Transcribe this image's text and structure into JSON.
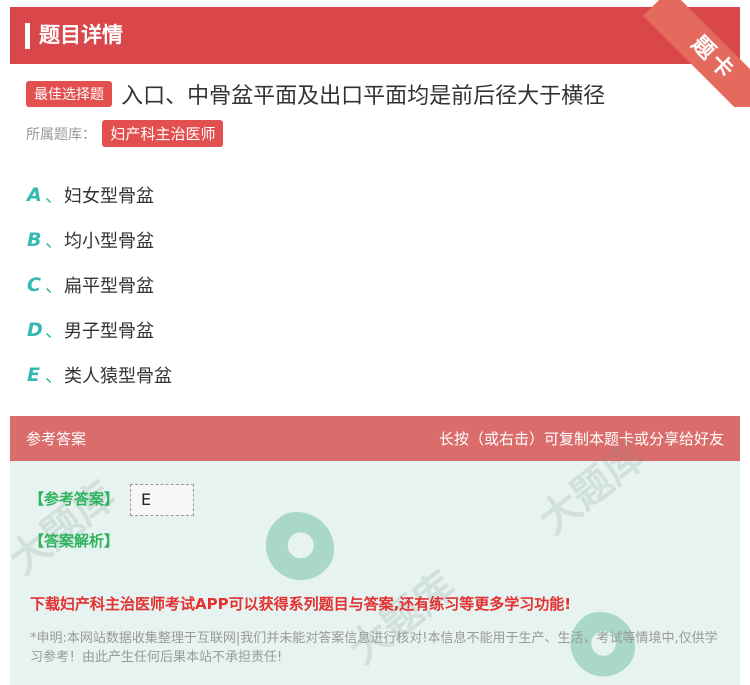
{
  "header": {
    "title": "题目详情",
    "ribbon": "题卡"
  },
  "question": {
    "type_tag": "最佳选择题",
    "text": "入口、中骨盆平面及出口平面均是前后径大于横径",
    "bank_label": "所属题库：",
    "bank_name": "妇产科主治医师"
  },
  "options": [
    {
      "letter": "A",
      "sep": "、",
      "text": "妇女型骨盆"
    },
    {
      "letter": "B",
      "sep": "、",
      "text": "均小型骨盆"
    },
    {
      "letter": "C",
      "sep": "、",
      "text": "扁平型骨盆"
    },
    {
      "letter": "D",
      "sep": "、",
      "text": "男子型骨盆"
    },
    {
      "letter": "E",
      "sep": "、",
      "text": "类人猿型骨盆"
    }
  ],
  "answer": {
    "section_title": "参考答案",
    "hint": "长按（或右击）可复制本题卡或分享给好友",
    "ref_label": "【参考答案】",
    "ref_value": "E",
    "analysis_label": "【答案解析】",
    "download": "下载妇产科主治医师考试APP可以获得系列题目与答案,还有练习等更多学习功能!",
    "disclaimer": "*申明:本网站数据收集整理于互联网|我们并未能对答案信息进行核对!本信息不能用于生产、生活、考试等情境中,仅供学习参考！由此产生任何后果本站不承担责任!"
  },
  "colors": {
    "header_red": "#d9474a",
    "option_teal": "#35b8b0",
    "answer_bg": "#e6f3f0",
    "answer_green": "#2fb35f"
  }
}
